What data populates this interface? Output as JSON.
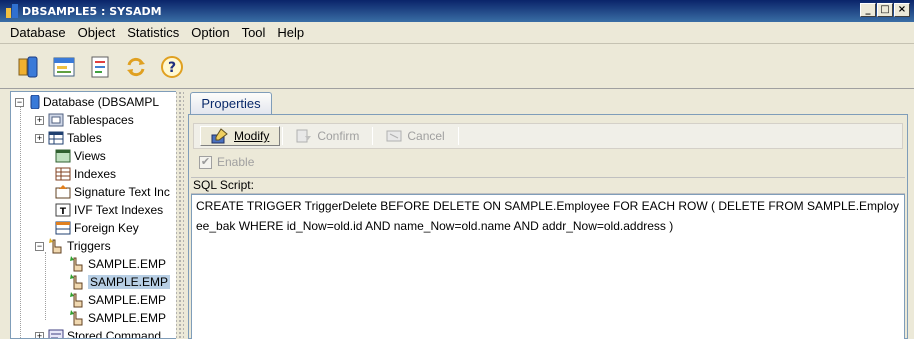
{
  "window": {
    "title": "DBSAMPLE5 : SYSADM",
    "controls": [
      "_",
      "□",
      "×"
    ]
  },
  "menu": [
    "Database",
    "Object",
    "Statistics",
    "Option",
    "Tool",
    "Help"
  ],
  "toolbar": {
    "buttons": [
      "connect-icon",
      "toolbar-view-icon",
      "report-icon",
      "refresh-icon",
      "help-icon"
    ]
  },
  "tree": {
    "root": "Database (DBSAMPL",
    "items": [
      "Tablespaces",
      "Tables",
      "Views",
      "Indexes",
      "Signature Text Inc",
      "IVF Text Indexes",
      "Foreign Key",
      "Triggers"
    ],
    "triggers": [
      "SAMPLE.EMP",
      "SAMPLE.EMP",
      "SAMPLE.EMP",
      "SAMPLE.EMP"
    ],
    "last": "Stored Command"
  },
  "tabs": {
    "properties": "Properties"
  },
  "actions": {
    "modify": "Modify",
    "confirm": "Confirm",
    "cancel": "Cancel"
  },
  "enable_label": "Enable",
  "sql": {
    "label": "SQL Script:",
    "text": "CREATE TRIGGER TriggerDelete BEFORE DELETE ON SAMPLE.Employee FOR EACH ROW ( DELETE FROM SAMPLE.Employee_bak WHERE id_Now=old.id AND name_Now=old.name AND addr_Now=old.address )"
  }
}
